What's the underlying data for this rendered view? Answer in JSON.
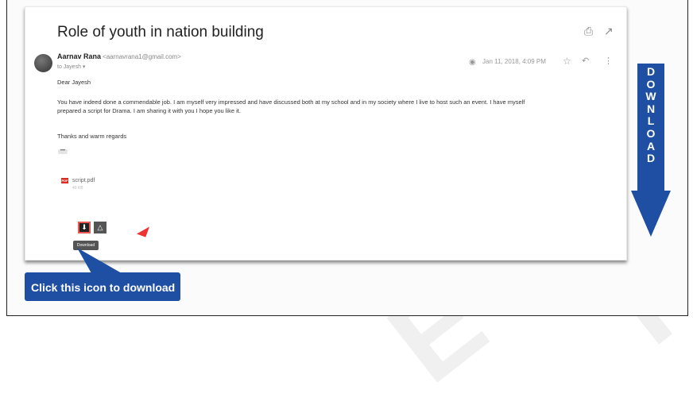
{
  "email": {
    "subject": "Role of youth in nation building",
    "sender_name": "Aarnav Rana",
    "sender_email": "<aarnavrana1@gmail.com>",
    "to_line": "to Jayesh ▾",
    "date": "Jan 11, 2018, 4:09 PM",
    "greeting": "Dear Jayesh",
    "body_line1": "You have indeed done a commendable job. I am myself very impressed and have discussed both at my school and in my society where I live to host such an event. I have myself",
    "body_line2": "prepared a script for Drama. I am sharing it with you I hope you like it.",
    "closing": "Thanks and warm regards",
    "ellipsis": "•••"
  },
  "attachment": {
    "badge": "PDF",
    "filename": "script.pdf",
    "size": "40 KB",
    "tooltip": "Download"
  },
  "callout": {
    "text": "Click this icon to download"
  },
  "banner": {
    "text": "DOWNLOAD"
  },
  "icons": {
    "print": "printer-icon",
    "popout": "open-in-new-icon",
    "eye": "eye-icon",
    "star": "star-icon",
    "reply": "reply-icon",
    "more": "more-vert-icon",
    "download": "download-icon",
    "drive": "drive-icon"
  },
  "colors": {
    "accent_blue": "#1f4fa3",
    "pdf_red": "#d93025",
    "cursor_red": "#e33"
  }
}
